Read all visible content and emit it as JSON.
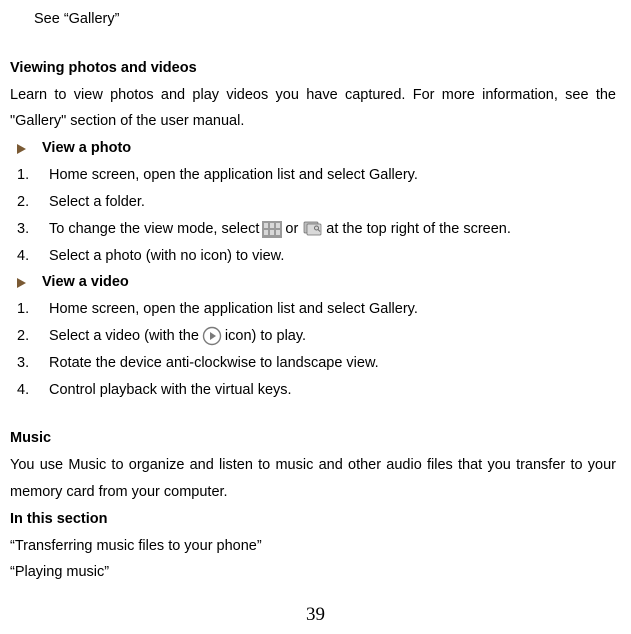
{
  "top_ref": "See “Gallery”",
  "section1": {
    "heading": "Viewing photos and videos",
    "intro": "Learn to view photos and play videos you have captured. For more information, see the \"Gallery\" section of the user manual.",
    "photo_heading": "View a photo",
    "photo_steps": {
      "n1": "1.",
      "t1": "Home screen, open the application list and select Gallery.",
      "n2": "2.",
      "t2": "Select a folder.",
      "n3": "3.",
      "t3a": "To change the view mode, select ",
      "t3b": " or ",
      "t3c": " at the top right of the screen.",
      "n4": "4.",
      "t4": "Select a photo (with no icon) to view."
    },
    "video_heading": "View a video",
    "video_steps": {
      "n1": "1.",
      "t1": "Home screen, open the application list and select Gallery.",
      "n2": "2.",
      "t2a": "Select a video (with the ",
      "t2b": " icon) to play.",
      "n3": "3.",
      "t3": "Rotate the device anti-clockwise to landscape view.",
      "n4": "4.",
      "t4": "Control playback with the virtual keys."
    }
  },
  "section2": {
    "heading": "Music",
    "intro": "You use Music to organize and listen to music and other audio files that you transfer to your memory card from your computer.",
    "sub_heading": "In this section",
    "line1": "“Transferring music files to your phone”",
    "line2": "“Playing music”"
  },
  "page_number": "39"
}
